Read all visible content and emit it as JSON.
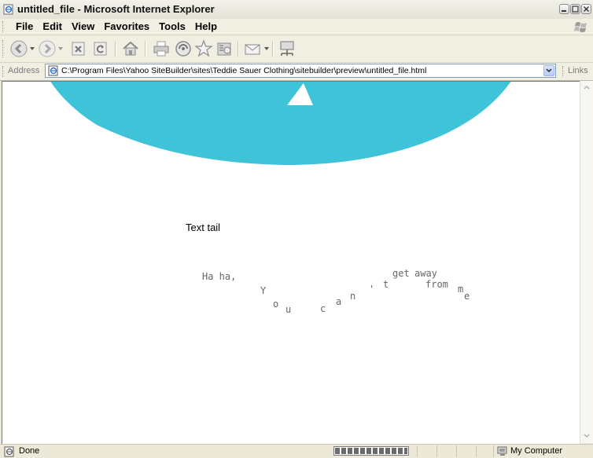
{
  "window": {
    "title": "untitled_file - Microsoft Internet Explorer"
  },
  "menu": {
    "items": [
      "File",
      "Edit",
      "View",
      "Favorites",
      "Tools",
      "Help"
    ]
  },
  "toolbar": {
    "buttons": [
      "back-icon",
      "forward-icon",
      "stop-icon",
      "refresh-icon",
      "home-icon",
      "print-icon",
      "media-icon",
      "favorites-star-icon",
      "history-icon",
      "mail-icon",
      "network-icon"
    ]
  },
  "address": {
    "label": "Address",
    "value": "C:\\Program Files\\Yahoo SiteBuilder\\sites\\Teddie Sauer Clothing\\sitebuilder\\preview\\untitled_file.html",
    "links_label": "Links"
  },
  "page": {
    "heading": "Text tail",
    "tail_chars": [
      "Ha ha,",
      "Y",
      "o",
      "u",
      "c",
      "a",
      "n",
      "'",
      "t",
      "get",
      "away",
      "from",
      "m",
      "e"
    ],
    "accent_color": "#3fc3d9"
  },
  "status": {
    "text": "Done",
    "progress": 1.0,
    "zone": "My Computer"
  }
}
